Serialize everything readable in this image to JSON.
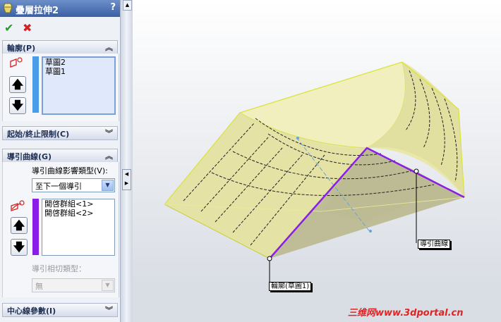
{
  "property_manager": {
    "title": "疊層拉伸2",
    "help_icon": "?",
    "ok_icon": "✔",
    "cancel_icon": "✖",
    "profile_section": {
      "header": "輪廓(P)",
      "items": [
        "草圖2",
        "草圖1"
      ]
    },
    "start_end_section": {
      "header": "起始/終止限制(C)"
    },
    "guide_section": {
      "header": "導引曲線(G)",
      "influence_label": "導引曲線影響類型(V):",
      "influence_value": "至下一個導引",
      "items": [
        "開啓群組<1>",
        "開啓群組<2>"
      ],
      "tangency_label": "導引相切類型：",
      "tangency_value": "無"
    },
    "centerline_section": {
      "header": "中心線參數(I)"
    }
  },
  "viewport": {
    "callout_guide": "導引曲線",
    "callout_profile": "輪廓(草圖1)",
    "watermark": "三维网www.3dportal.cn"
  },
  "colors": {
    "title_bar": "#3a5fa4",
    "accent_purple": "#8a1ee6",
    "surface": "#e8e6a8",
    "blue_bar": "#4a9be8"
  }
}
